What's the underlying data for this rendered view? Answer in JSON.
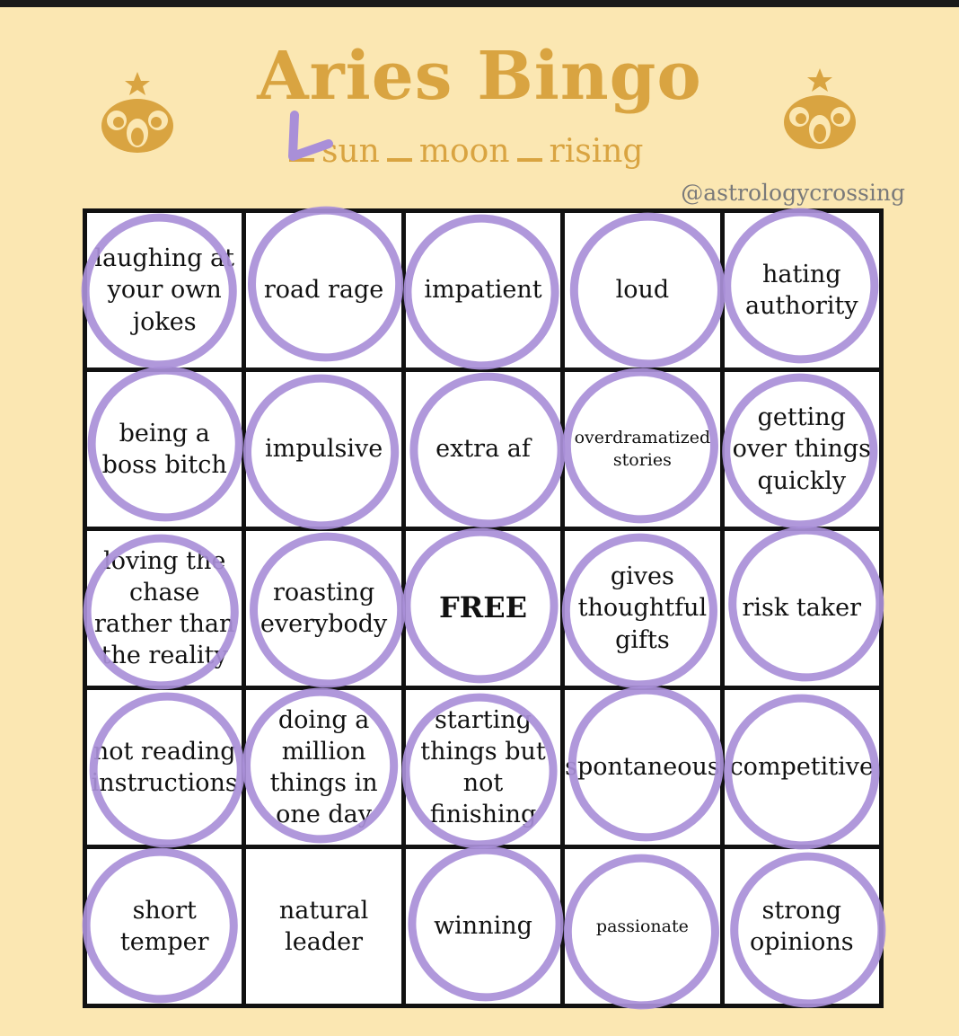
{
  "title": "Aries Bingo",
  "subtitle": {
    "options": [
      "sun",
      "moon",
      "rising"
    ],
    "checked": "sun"
  },
  "handle": "@astrologycrossing",
  "colors": {
    "background": "#fbe7b2",
    "title": "#d9a441",
    "marker": "#a98fd8",
    "grid": "#111111"
  },
  "icons": {
    "emblem": "aries-ram-icon"
  },
  "cells": [
    "laughing at your own jokes",
    "road rage",
    "impatient",
    "loud",
    "hating authority",
    "being a boss bitch",
    "impulsive",
    "extra af",
    "overdramatized stories",
    "getting over things quickly",
    "loving the chase rather than the reality",
    "roasting everybody",
    "FREE",
    "gives thoughtful gifts",
    "risk taker",
    "not reading instructions",
    "doing a million things in one day",
    "starting things but not finishing",
    "spontaneous",
    "competitive",
    "short temper",
    "natural leader",
    "winning",
    "passionate",
    "strong opinions"
  ],
  "marked": [
    true,
    true,
    true,
    true,
    true,
    true,
    true,
    true,
    true,
    true,
    true,
    true,
    true,
    true,
    true,
    true,
    true,
    true,
    true,
    true,
    true,
    false,
    true,
    true,
    true
  ]
}
